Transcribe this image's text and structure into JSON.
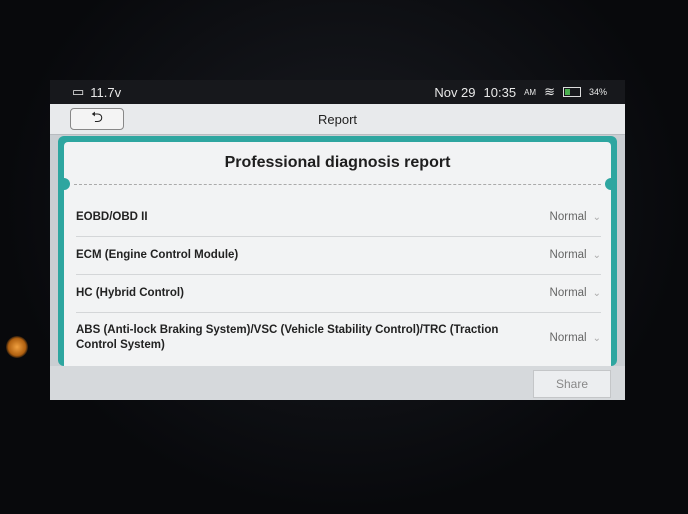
{
  "status": {
    "voltage": "11.7v",
    "date": "Nov 29",
    "time": "10:35",
    "ampm": "AM",
    "battery": "34%"
  },
  "titlebar": {
    "title": "Report",
    "back_icon": "back-arrow-icon"
  },
  "report": {
    "heading": "Professional diagnosis report"
  },
  "systems": [
    {
      "label": "EOBD/OBD II",
      "status": "Normal"
    },
    {
      "label": "ECM (Engine Control Module)",
      "status": "Normal"
    },
    {
      "label": "HC (Hybrid Control)",
      "status": "Normal"
    },
    {
      "label": "ABS (Anti-lock Braking System)/VSC (Vehicle Stability Control)/TRC (Traction Control System)",
      "status": "Normal"
    }
  ],
  "footer": {
    "share_label": "Share"
  },
  "colors": {
    "accent": "#2ea6a0",
    "statusbar": "#17181c"
  }
}
